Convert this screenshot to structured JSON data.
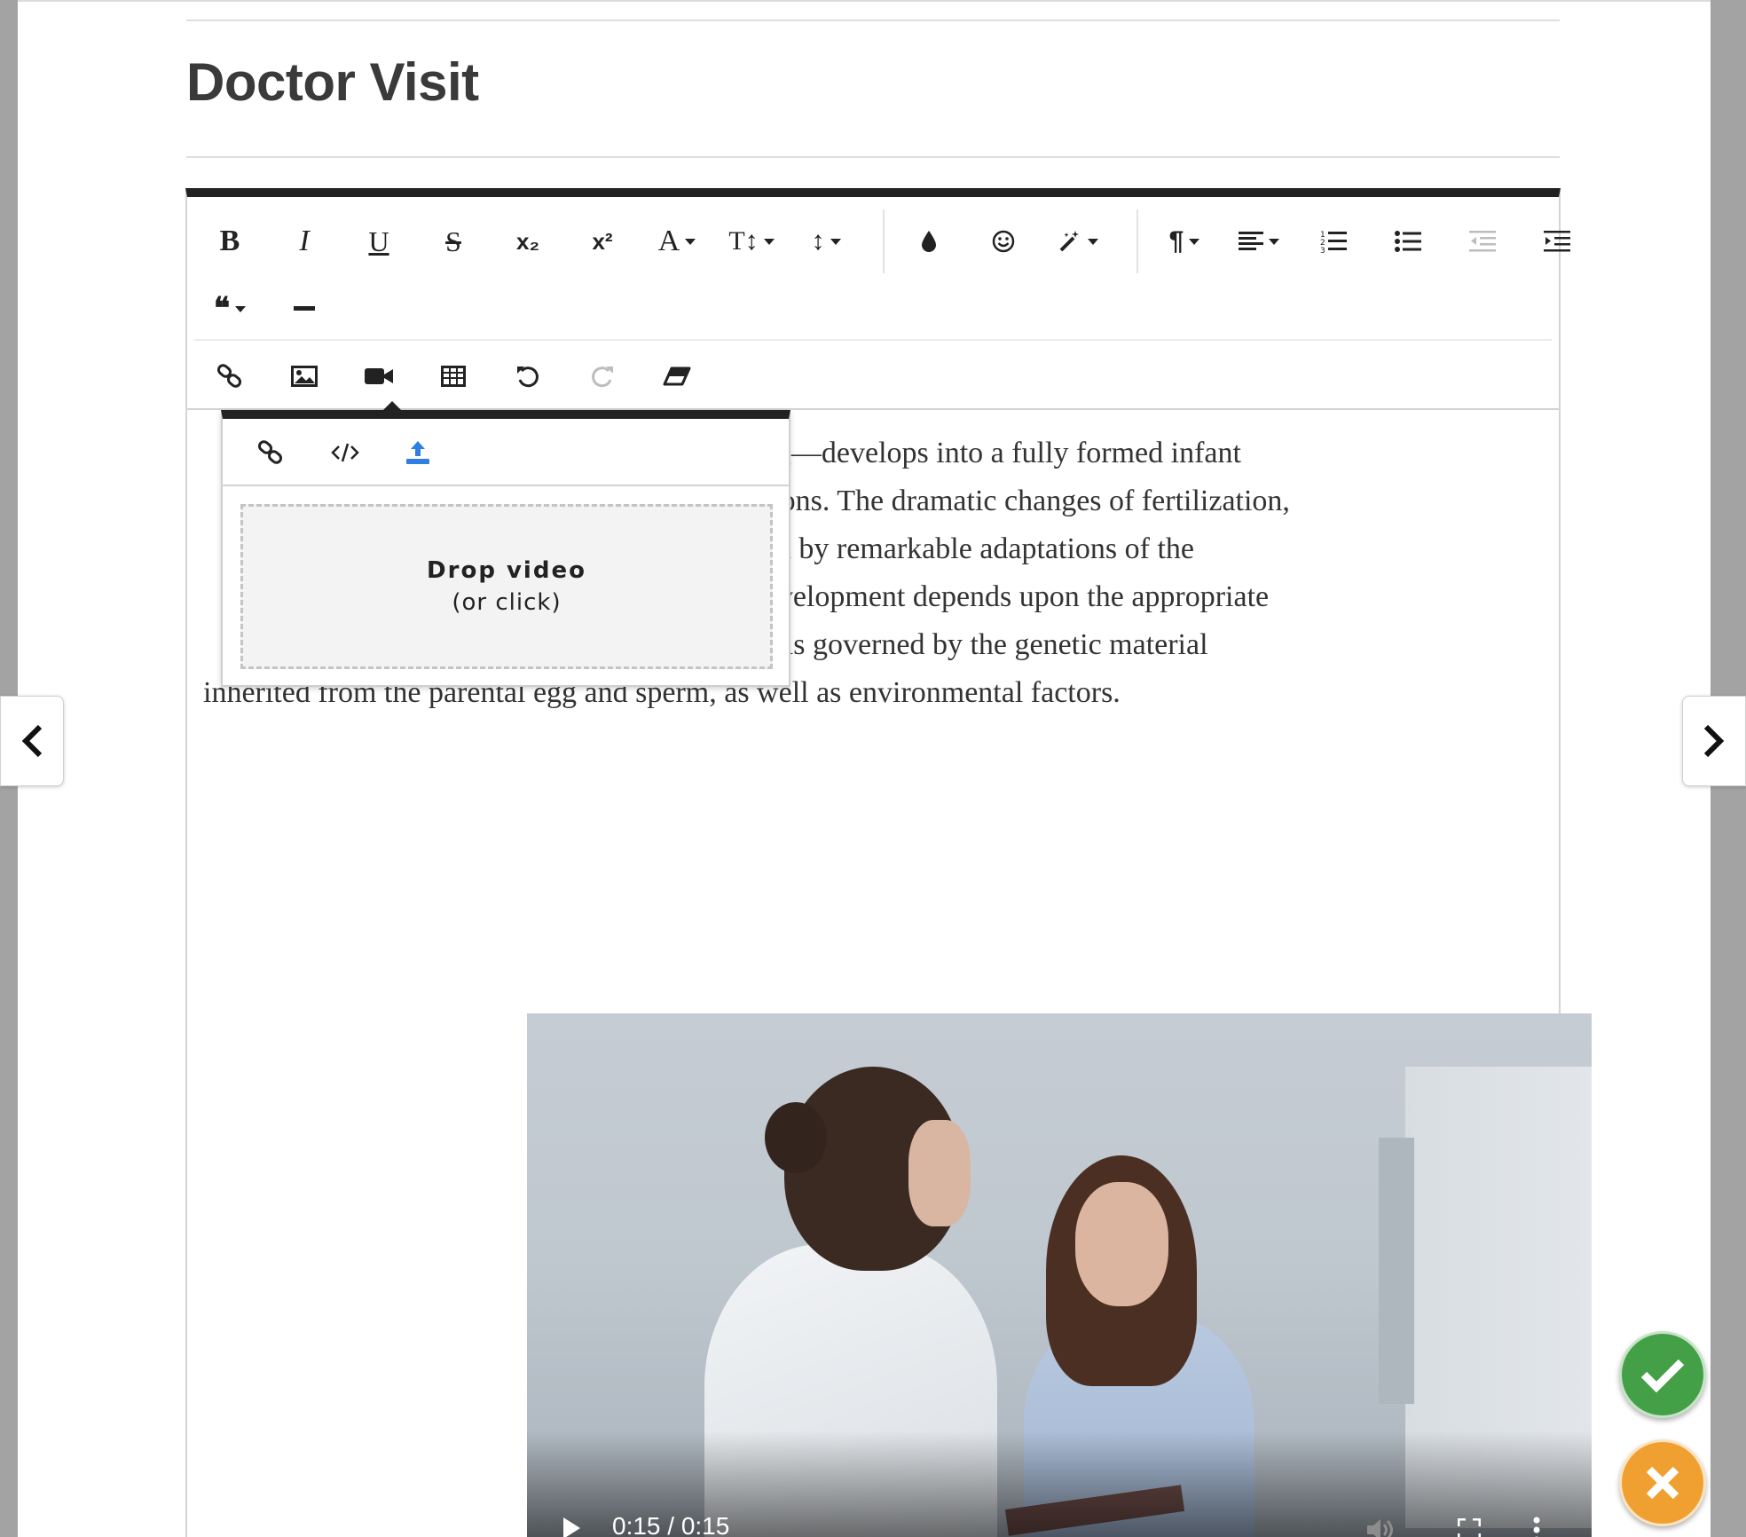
{
  "page": {
    "title": "Doctor Visit"
  },
  "toolbar": {
    "row1": [
      {
        "name": "bold",
        "label": "B"
      },
      {
        "name": "italic",
        "label": "I"
      },
      {
        "name": "underline",
        "label": "U"
      },
      {
        "name": "strikethrough",
        "label": "S"
      },
      {
        "name": "subscript",
        "label": "x₂"
      },
      {
        "name": "superscript",
        "label": "x²"
      },
      {
        "name": "font-family",
        "label": "A"
      },
      {
        "name": "font-size",
        "label": "T↕"
      },
      {
        "name": "line-height",
        "label": "↕"
      },
      {
        "name": "text-color",
        "label": ""
      },
      {
        "name": "emoticons",
        "label": "☺"
      },
      {
        "name": "inline-style",
        "label": ""
      },
      {
        "name": "paragraph-format",
        "label": "¶"
      },
      {
        "name": "align",
        "label": ""
      },
      {
        "name": "ordered-list",
        "label": ""
      },
      {
        "name": "unordered-list",
        "label": ""
      },
      {
        "name": "outdent",
        "label": ""
      },
      {
        "name": "indent",
        "label": ""
      }
    ],
    "row2": [
      {
        "name": "quote",
        "label": "❝"
      },
      {
        "name": "horizontal-line",
        "label": ""
      }
    ],
    "row3": [
      {
        "name": "insert-link"
      },
      {
        "name": "insert-image"
      },
      {
        "name": "insert-video"
      },
      {
        "name": "insert-table"
      },
      {
        "name": "undo"
      },
      {
        "name": "redo"
      },
      {
        "name": "clear-formatting"
      }
    ]
  },
  "content": {
    "lines": [
      "                                                  —a fertilized egg—develops into a fully formed infant",
      "                                                  pecialized functions. The dramatic changes of fertilization,",
      "                                                  nent are followed by remarkable adaptations of the",
      "                                                  ring’s normal development depends upon the appropriate",
      "                                                  ns. This, in turn, is governed by the genetic material",
      "inherited from the parental egg and sperm, as well as environmental factors."
    ]
  },
  "video_popup": {
    "tabs": [
      "link-icon",
      "embed-code-icon",
      "upload-icon"
    ],
    "drop_title": "Drop video",
    "drop_subtitle": "(or click)"
  },
  "video": {
    "time": "0:15 / 0:15",
    "progress": 1.0
  },
  "colors": {
    "accent_upload": "#2f7fe0",
    "ok": "#43a047",
    "cancel": "#f0a030",
    "toolbar_top": "#222222"
  }
}
